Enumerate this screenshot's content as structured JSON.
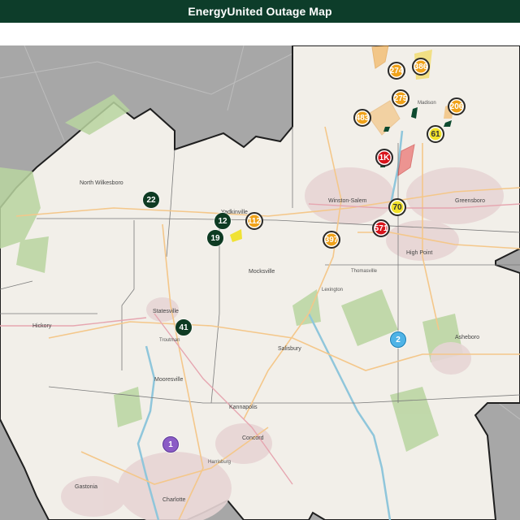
{
  "header": {
    "title": "EnergyUnited Outage Map"
  },
  "colors": {
    "header_bg": "#0d3d2a",
    "map_land": "#f2efe9",
    "outside_area": "#a8a8a8",
    "forest": "#b5d29c",
    "water": "#aad3df",
    "urban": "#e6d6d6",
    "boundary": "#222222"
  },
  "marker_styles": {
    "dark-green": {
      "fill": "#0e3b23",
      "ring": "#0e3b23",
      "text": "#ffffff"
    },
    "orange": {
      "fill": "#f0a21a",
      "ring": "#2a2a2a",
      "text": "#ffffff"
    },
    "red": {
      "fill": "#d8141b",
      "ring": "#2a2a2a",
      "text": "#ffffff"
    },
    "yellow": {
      "fill": "#f2e22a",
      "ring": "#2a2a2a",
      "text": "#333333"
    },
    "light-blue": {
      "fill": "#4fb3e6",
      "ring": "#1c7fb3",
      "text": "#ffffff"
    },
    "purple": {
      "fill": "#8b5cc6",
      "ring": "#5b3796",
      "text": "#ffffff"
    }
  },
  "outage_clusters": [
    {
      "count": "22",
      "style": "dark-green"
    },
    {
      "count": "12",
      "style": "dark-green"
    },
    {
      "count": "19",
      "style": "dark-green"
    },
    {
      "count": "41",
      "style": "dark-green"
    },
    {
      "count": "112",
      "style": "orange"
    },
    {
      "count": "397",
      "style": "orange"
    },
    {
      "count": "274",
      "style": "orange"
    },
    {
      "count": "386",
      "style": "orange"
    },
    {
      "count": "275",
      "style": "orange"
    },
    {
      "count": "483",
      "style": "orange"
    },
    {
      "count": "206",
      "style": "orange"
    },
    {
      "count": "61",
      "style": "yellow"
    },
    {
      "count": "70",
      "style": "yellow"
    },
    {
      "count": "1K",
      "style": "red"
    },
    {
      "count": "571",
      "style": "red"
    },
    {
      "count": "2",
      "style": "light-blue"
    },
    {
      "count": "1",
      "style": "purple"
    }
  ],
  "places": [
    "North Wilkesboro",
    "Yadkinville",
    "Winston-Salem",
    "Greensboro",
    "High Point",
    "Statesville",
    "Mocksville",
    "Salisbury",
    "Asheboro",
    "Hickory",
    "Mooresville",
    "Kannapolis",
    "Concord",
    "Charlotte",
    "Gastonia",
    "Madison",
    "Troutman",
    "Harrisburg",
    "Lexington",
    "Thomasville"
  ]
}
